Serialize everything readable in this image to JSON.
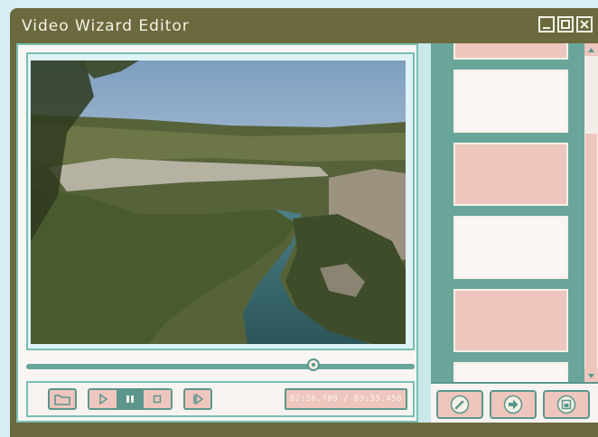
{
  "window": {
    "title": "Video Wizard Editor",
    "buttons": {
      "minimize": "minimize-icon",
      "maximize": "maximize-icon",
      "close": "close-icon"
    }
  },
  "player": {
    "time_display": "02:56.789 / 03:55.456",
    "seek_progress": 0.74,
    "buttons": {
      "open": "folder-icon",
      "play": "play-icon",
      "pause": "pause-icon",
      "stop": "stop-icon",
      "next_frame": "next-frame-icon"
    }
  },
  "timeline": {
    "thumbnail_colors": [
      "#eec6bd",
      "#fbf5f4",
      "#eec6bd",
      "#fbf5f4",
      "#eec6bd",
      "#fbf5f4"
    ]
  },
  "actions": {
    "edit": "pencil-icon",
    "export": "arrow-right-icon",
    "save": "save-icon"
  },
  "colors": {
    "accent": "#6aa59a",
    "button": "#eec6bd",
    "titlebar": "#6b6a3e"
  }
}
